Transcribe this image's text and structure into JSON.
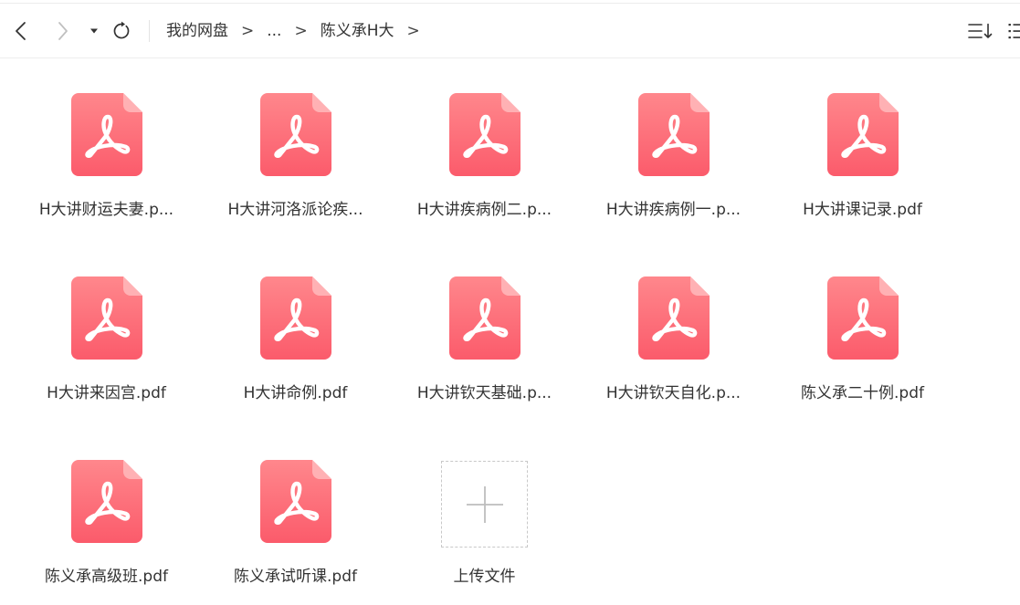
{
  "toolbar": {
    "back_icon": "chevron-left-icon",
    "forward_icon": "chevron-right-icon",
    "history_icon": "caret-down-icon",
    "refresh_icon": "refresh-icon",
    "sort_icon": "sort-icon",
    "view_icon": "list-view-icon"
  },
  "breadcrumb": {
    "items": [
      "我的网盘",
      "...",
      "陈义承H大"
    ],
    "separator": ">"
  },
  "files": [
    {
      "name": "H大讲财运夫妻.p...",
      "icon": "pdf-file-icon"
    },
    {
      "name": "H大讲河洛派论疾...",
      "icon": "pdf-file-icon"
    },
    {
      "name": "H大讲疾病例二.p...",
      "icon": "pdf-file-icon"
    },
    {
      "name": "H大讲疾病例一.p...",
      "icon": "pdf-file-icon"
    },
    {
      "name": "H大讲课记录.pdf",
      "icon": "pdf-file-icon"
    },
    {
      "name": "H大讲来因宫.pdf",
      "icon": "pdf-file-icon"
    },
    {
      "name": "H大讲命例.pdf",
      "icon": "pdf-file-icon"
    },
    {
      "name": "H大讲钦天基础.p...",
      "icon": "pdf-file-icon"
    },
    {
      "name": "H大讲钦天自化.p...",
      "icon": "pdf-file-icon"
    },
    {
      "name": "陈义承二十例.pdf",
      "icon": "pdf-file-icon"
    },
    {
      "name": "陈义承高级班.pdf",
      "icon": "pdf-file-icon"
    },
    {
      "name": "陈义承试听课.pdf",
      "icon": "pdf-file-icon"
    }
  ],
  "upload": {
    "label": "上传文件",
    "icon": "plus-icon"
  },
  "colors": {
    "pdf_top": "#ff878c",
    "pdf_bottom": "#fb5b6b",
    "pdf_fold": "#ffb1b4",
    "text": "#333333",
    "disabled_icon": "#c0c0c0"
  }
}
